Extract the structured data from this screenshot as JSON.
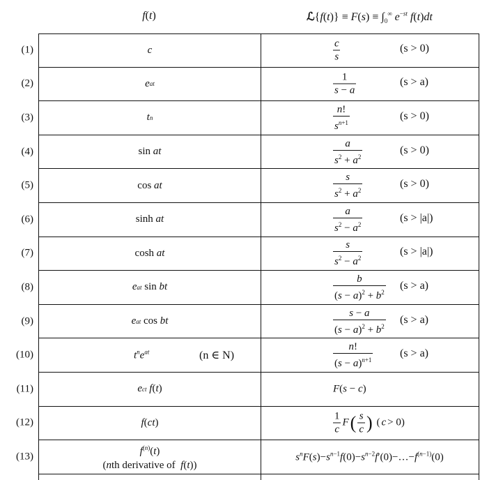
{
  "header": {
    "left": "f(t)",
    "right": "ℒ{f(t)} ≡ F(s) ≡ ∫₀^∞ e^(−st) f(t) dt"
  },
  "rows": [
    {
      "num": "(1)",
      "f": "c",
      "num_F": "c",
      "den_F": "s",
      "cond": "(s > 0)"
    },
    {
      "num": "(2)",
      "f": "e^(at)",
      "num_F": "1",
      "den_F": "s − a",
      "cond": "(s > a)"
    },
    {
      "num": "(3)",
      "f": "t^n",
      "num_F": "n!",
      "den_F": "s^(n+1)",
      "cond": "(s > 0)"
    },
    {
      "num": "(4)",
      "f": "sin at",
      "num_F": "a",
      "den_F": "s² + a²",
      "cond": "(s > 0)"
    },
    {
      "num": "(5)",
      "f": "cos at",
      "num_F": "s",
      "den_F": "s² + a²",
      "cond": "(s > 0)"
    },
    {
      "num": "(6)",
      "f": "sinh at",
      "num_F": "a",
      "den_F": "s² − a²",
      "cond": "(s > |a|)"
    },
    {
      "num": "(7)",
      "f": "cosh at",
      "num_F": "s",
      "den_F": "s² − a²",
      "cond": "(s > |a|)"
    },
    {
      "num": "(8)",
      "f": "e^(at) sin bt",
      "num_F": "b",
      "den_F": "(s − a)² + b²",
      "cond": "(s > a)"
    },
    {
      "num": "(9)",
      "f": "e^(at) cos bt",
      "num_F": "s − a",
      "den_F": "(s − a)² + b²",
      "cond": "(s > a)"
    },
    {
      "num": "(10)",
      "f": "t^n e^(at)",
      "f_cond": "(n ∈ N)",
      "num_F": "n!",
      "den_F": "(s − a)^(n+1)",
      "cond": "(s > a)"
    },
    {
      "num": "(11)",
      "f": "e^(ct) f(t)",
      "F": "F(s − c)"
    },
    {
      "num": "(12)",
      "f": "f(ct)",
      "F": "(1/c) F(s/c) (c > 0)"
    },
    {
      "num": "(13)",
      "f": "f^(n)(t)",
      "f_note": "(nth derivative of f(t))",
      "F": "sⁿF(s) − sⁿ⁻¹f(0) − sⁿ⁻²f′(0) − … − f⁽ⁿ⁻¹⁾(0)"
    }
  ]
}
